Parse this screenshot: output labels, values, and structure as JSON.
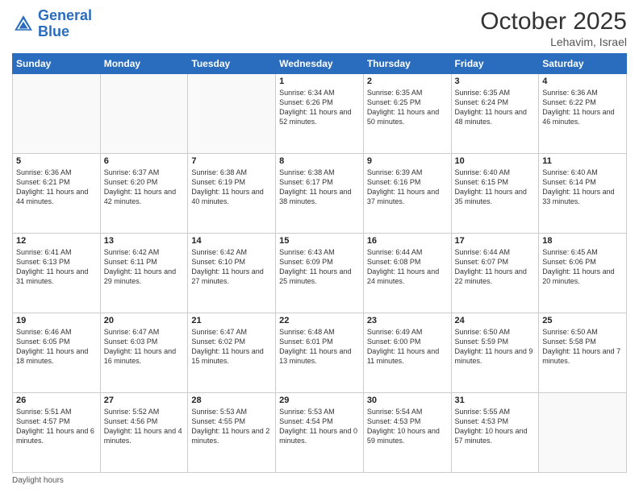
{
  "app": {
    "logo_text_general": "General",
    "logo_text_blue": "Blue"
  },
  "header": {
    "month": "October 2025",
    "location": "Lehavim, Israel"
  },
  "weekdays": [
    "Sunday",
    "Monday",
    "Tuesday",
    "Wednesday",
    "Thursday",
    "Friday",
    "Saturday"
  ],
  "footer": {
    "daylight_label": "Daylight hours"
  },
  "weeks": [
    [
      {
        "day": "",
        "info": ""
      },
      {
        "day": "",
        "info": ""
      },
      {
        "day": "",
        "info": ""
      },
      {
        "day": "1",
        "info": "Sunrise: 6:34 AM\nSunset: 6:26 PM\nDaylight: 11 hours\nand 52 minutes."
      },
      {
        "day": "2",
        "info": "Sunrise: 6:35 AM\nSunset: 6:25 PM\nDaylight: 11 hours\nand 50 minutes."
      },
      {
        "day": "3",
        "info": "Sunrise: 6:35 AM\nSunset: 6:24 PM\nDaylight: 11 hours\nand 48 minutes."
      },
      {
        "day": "4",
        "info": "Sunrise: 6:36 AM\nSunset: 6:22 PM\nDaylight: 11 hours\nand 46 minutes."
      }
    ],
    [
      {
        "day": "5",
        "info": "Sunrise: 6:36 AM\nSunset: 6:21 PM\nDaylight: 11 hours\nand 44 minutes."
      },
      {
        "day": "6",
        "info": "Sunrise: 6:37 AM\nSunset: 6:20 PM\nDaylight: 11 hours\nand 42 minutes."
      },
      {
        "day": "7",
        "info": "Sunrise: 6:38 AM\nSunset: 6:19 PM\nDaylight: 11 hours\nand 40 minutes."
      },
      {
        "day": "8",
        "info": "Sunrise: 6:38 AM\nSunset: 6:17 PM\nDaylight: 11 hours\nand 38 minutes."
      },
      {
        "day": "9",
        "info": "Sunrise: 6:39 AM\nSunset: 6:16 PM\nDaylight: 11 hours\nand 37 minutes."
      },
      {
        "day": "10",
        "info": "Sunrise: 6:40 AM\nSunset: 6:15 PM\nDaylight: 11 hours\nand 35 minutes."
      },
      {
        "day": "11",
        "info": "Sunrise: 6:40 AM\nSunset: 6:14 PM\nDaylight: 11 hours\nand 33 minutes."
      }
    ],
    [
      {
        "day": "12",
        "info": "Sunrise: 6:41 AM\nSunset: 6:13 PM\nDaylight: 11 hours\nand 31 minutes."
      },
      {
        "day": "13",
        "info": "Sunrise: 6:42 AM\nSunset: 6:11 PM\nDaylight: 11 hours\nand 29 minutes."
      },
      {
        "day": "14",
        "info": "Sunrise: 6:42 AM\nSunset: 6:10 PM\nDaylight: 11 hours\nand 27 minutes."
      },
      {
        "day": "15",
        "info": "Sunrise: 6:43 AM\nSunset: 6:09 PM\nDaylight: 11 hours\nand 25 minutes."
      },
      {
        "day": "16",
        "info": "Sunrise: 6:44 AM\nSunset: 6:08 PM\nDaylight: 11 hours\nand 24 minutes."
      },
      {
        "day": "17",
        "info": "Sunrise: 6:44 AM\nSunset: 6:07 PM\nDaylight: 11 hours\nand 22 minutes."
      },
      {
        "day": "18",
        "info": "Sunrise: 6:45 AM\nSunset: 6:06 PM\nDaylight: 11 hours\nand 20 minutes."
      }
    ],
    [
      {
        "day": "19",
        "info": "Sunrise: 6:46 AM\nSunset: 6:05 PM\nDaylight: 11 hours\nand 18 minutes."
      },
      {
        "day": "20",
        "info": "Sunrise: 6:47 AM\nSunset: 6:03 PM\nDaylight: 11 hours\nand 16 minutes."
      },
      {
        "day": "21",
        "info": "Sunrise: 6:47 AM\nSunset: 6:02 PM\nDaylight: 11 hours\nand 15 minutes."
      },
      {
        "day": "22",
        "info": "Sunrise: 6:48 AM\nSunset: 6:01 PM\nDaylight: 11 hours\nand 13 minutes."
      },
      {
        "day": "23",
        "info": "Sunrise: 6:49 AM\nSunset: 6:00 PM\nDaylight: 11 hours\nand 11 minutes."
      },
      {
        "day": "24",
        "info": "Sunrise: 6:50 AM\nSunset: 5:59 PM\nDaylight: 11 hours\nand 9 minutes."
      },
      {
        "day": "25",
        "info": "Sunrise: 6:50 AM\nSunset: 5:58 PM\nDaylight: 11 hours\nand 7 minutes."
      }
    ],
    [
      {
        "day": "26",
        "info": "Sunrise: 5:51 AM\nSunset: 4:57 PM\nDaylight: 11 hours\nand 6 minutes."
      },
      {
        "day": "27",
        "info": "Sunrise: 5:52 AM\nSunset: 4:56 PM\nDaylight: 11 hours\nand 4 minutes."
      },
      {
        "day": "28",
        "info": "Sunrise: 5:53 AM\nSunset: 4:55 PM\nDaylight: 11 hours\nand 2 minutes."
      },
      {
        "day": "29",
        "info": "Sunrise: 5:53 AM\nSunset: 4:54 PM\nDaylight: 11 hours\nand 0 minutes."
      },
      {
        "day": "30",
        "info": "Sunrise: 5:54 AM\nSunset: 4:53 PM\nDaylight: 10 hours\nand 59 minutes."
      },
      {
        "day": "31",
        "info": "Sunrise: 5:55 AM\nSunset: 4:53 PM\nDaylight: 10 hours\nand 57 minutes."
      },
      {
        "day": "",
        "info": ""
      }
    ]
  ]
}
